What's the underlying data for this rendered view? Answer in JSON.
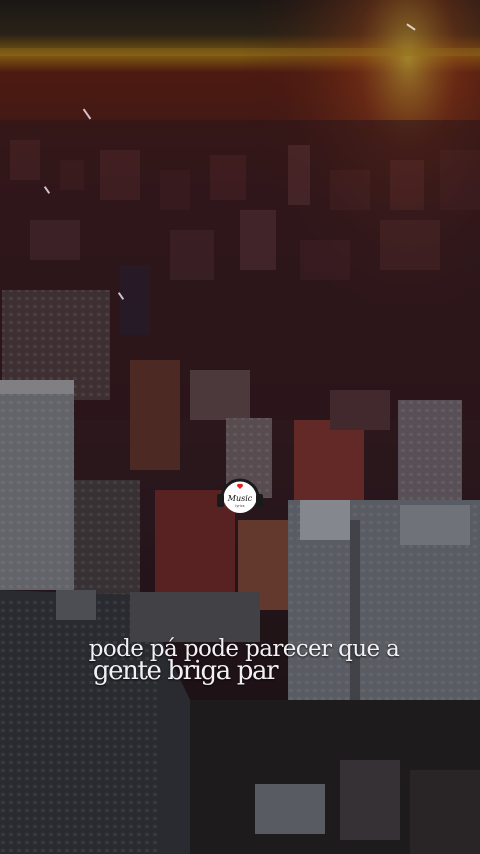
{
  "video": {
    "lyrics": {
      "line1": "pode pá pode parecer que a",
      "line2": "gente briga par"
    },
    "logo": {
      "icon": "headphones-heart-icon",
      "title": "Music",
      "subtitle": "lyrics"
    },
    "colors": {
      "sky_glow": "#e0a020",
      "city_tint": "#6a2a2a",
      "text": "#f2f0f4"
    }
  }
}
